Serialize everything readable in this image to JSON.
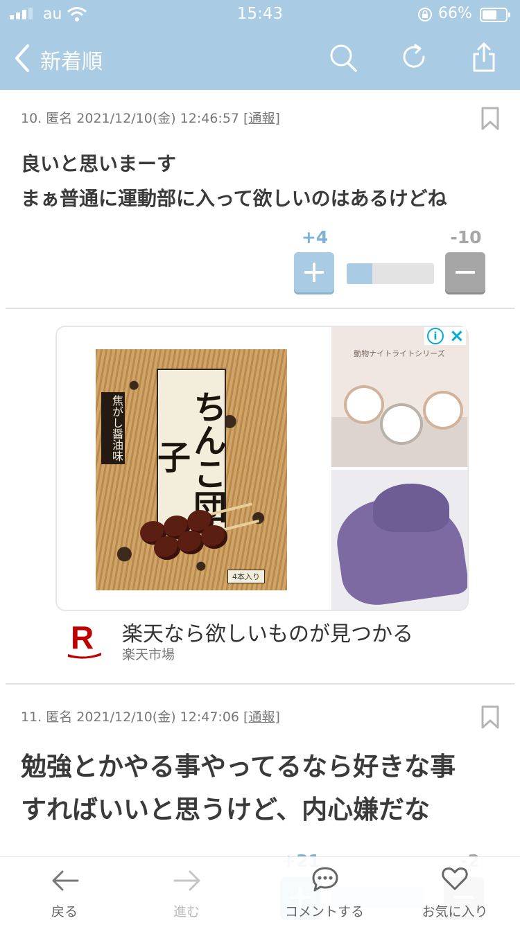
{
  "status_bar": {
    "carrier": "au",
    "time": "15:43",
    "battery_percent": "66%",
    "signal_bars": 3,
    "battery_fill": 0.66
  },
  "header": {
    "back_label": "新着順",
    "icons": [
      "search-icon",
      "refresh-icon",
      "share-icon"
    ],
    "background_color": "#a9cbe3"
  },
  "comments": [
    {
      "meta": "10. 匿名 2021/12/10(金) 12:46:57 [",
      "report_label": "通報",
      "meta_close": "]",
      "lines": [
        "良いと思いまーす",
        "まぁ普通に運動部に入って欲しいのはあるけどね"
      ],
      "plus": "+4",
      "minus": "-10",
      "plus_ratio": 0.29
    },
    {
      "meta": "11. 匿名 2021/12/10(金) 12:47:06 [",
      "report_label": "通報",
      "meta_close": "]",
      "lines": [
        "勉強とかやる事やってるなら好きな事",
        "すればいいと思うけど、内心嫌だな"
      ],
      "plus": "+21",
      "minus": "-2"
    }
  ],
  "ad": {
    "product": {
      "title": "ちんこ団子",
      "flavor": "焦がし醤油味",
      "count": "4本入り"
    },
    "side_top_text": "動物ナイトライトシリーズ",
    "headline": "楽天なら欲しいものが見つかる",
    "sponsor": "楽天市場",
    "logo_letter": "R",
    "brand_color": "#bf0000"
  },
  "bottom_nav": {
    "back": "戻る",
    "forward": "進む",
    "comment": "コメントする",
    "favorite": "お気に入り"
  }
}
